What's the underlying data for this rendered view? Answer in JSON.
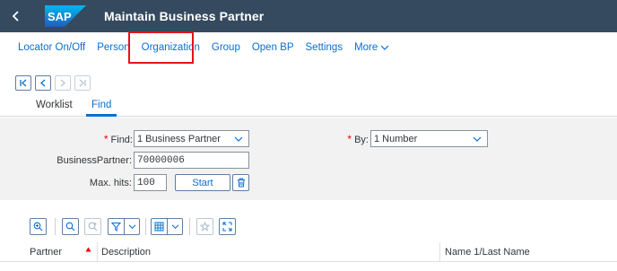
{
  "shell": {
    "title": "Maintain Business Partner",
    "logo_text": "SAP",
    "colors": {
      "shell_bg": "#354a5f",
      "accent": "#0a6ed1",
      "highlight_box": "#e8101c"
    }
  },
  "toolbar": {
    "items": [
      "Locator On/Off",
      "Person",
      "Organization",
      "Group",
      "Open BP",
      "Settings"
    ],
    "more_label": "More",
    "highlighted_item": "Organization"
  },
  "tabs": [
    {
      "label": "Worklist",
      "selected": false
    },
    {
      "label": "Find",
      "selected": true
    }
  ],
  "find": {
    "find_label": "Find:",
    "find_value": "1 Business Partner",
    "by_label": "By:",
    "by_value": "1 Number",
    "bp_label": "BusinessPartner:",
    "bp_value": "70000006",
    "maxhits_label": "Max. hits:",
    "maxhits_value": "100",
    "start_label": "Start",
    "required_marker": "*"
  },
  "table": {
    "columns": [
      "Partner",
      "Description",
      "Name 1/Last Name"
    ]
  },
  "icons": {
    "back": "chevron-left-icon",
    "paging": [
      "first-page-icon",
      "previous-page-icon",
      "next-page-icon",
      "last-page-icon"
    ],
    "table_toolbar": [
      "zoom-details-icon",
      "search-icon",
      "search-next-icon",
      "filter-icon",
      "layout-icon",
      "export-icon",
      "fullscreen-icon"
    ]
  }
}
